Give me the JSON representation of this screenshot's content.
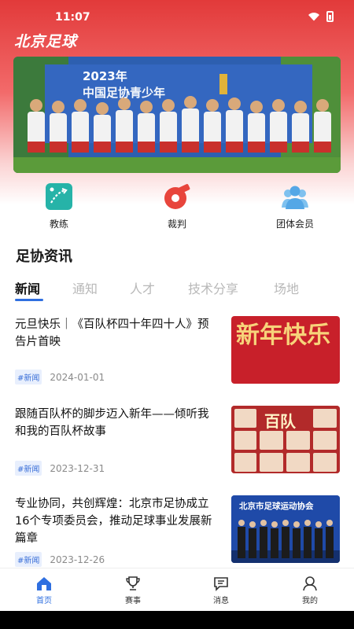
{
  "status_bar": {
    "time": "11:07"
  },
  "app": {
    "title": "北京足球"
  },
  "banner": {
    "year_text": "2023年",
    "subtitle_text": "中国足协青少年"
  },
  "quick_links": [
    {
      "label": "教练",
      "icon": "coach-board-icon",
      "color": "#26b3a8"
    },
    {
      "label": "裁判",
      "icon": "referee-whistle-icon",
      "color": "#e8453c"
    },
    {
      "label": "团体会员",
      "icon": "group-members-icon",
      "color": "#55a7e6"
    }
  ],
  "section": {
    "title": "足协资讯"
  },
  "tabs": [
    {
      "label": "新闻",
      "active": true
    },
    {
      "label": "通知",
      "active": false
    },
    {
      "label": "人才",
      "active": false
    },
    {
      "label": "技术分享",
      "active": false
    },
    {
      "label": "场地",
      "active": false
    }
  ],
  "news": [
    {
      "title": "元旦快乐｜《百队杯四十年四十人》预告片首映",
      "tag": "#新闻",
      "date": "2024-01-01",
      "thumb_text": "新年快乐"
    },
    {
      "title": "跟随百队杯的脚步迈入新年——倾听我和我的百队杯故事",
      "tag": "#新闻",
      "date": "2023-12-31",
      "thumb_text": "百队"
    },
    {
      "title": "专业协同，共创辉煌：北京市足协成立16个专项委员会，推动足球事业发展新篇章",
      "tag": "#新闻",
      "date": "2023-12-26",
      "thumb_text": "北京市足球运动协会"
    }
  ],
  "tabbar": [
    {
      "label": "首页",
      "icon": "home-icon",
      "active": true
    },
    {
      "label": "赛事",
      "icon": "trophy-icon",
      "active": false
    },
    {
      "label": "消息",
      "icon": "message-icon",
      "active": false
    },
    {
      "label": "我的",
      "icon": "profile-icon",
      "active": false
    }
  ],
  "colors": {
    "brand_red": "#e23a3a",
    "accent_blue": "#2f6fe0"
  }
}
